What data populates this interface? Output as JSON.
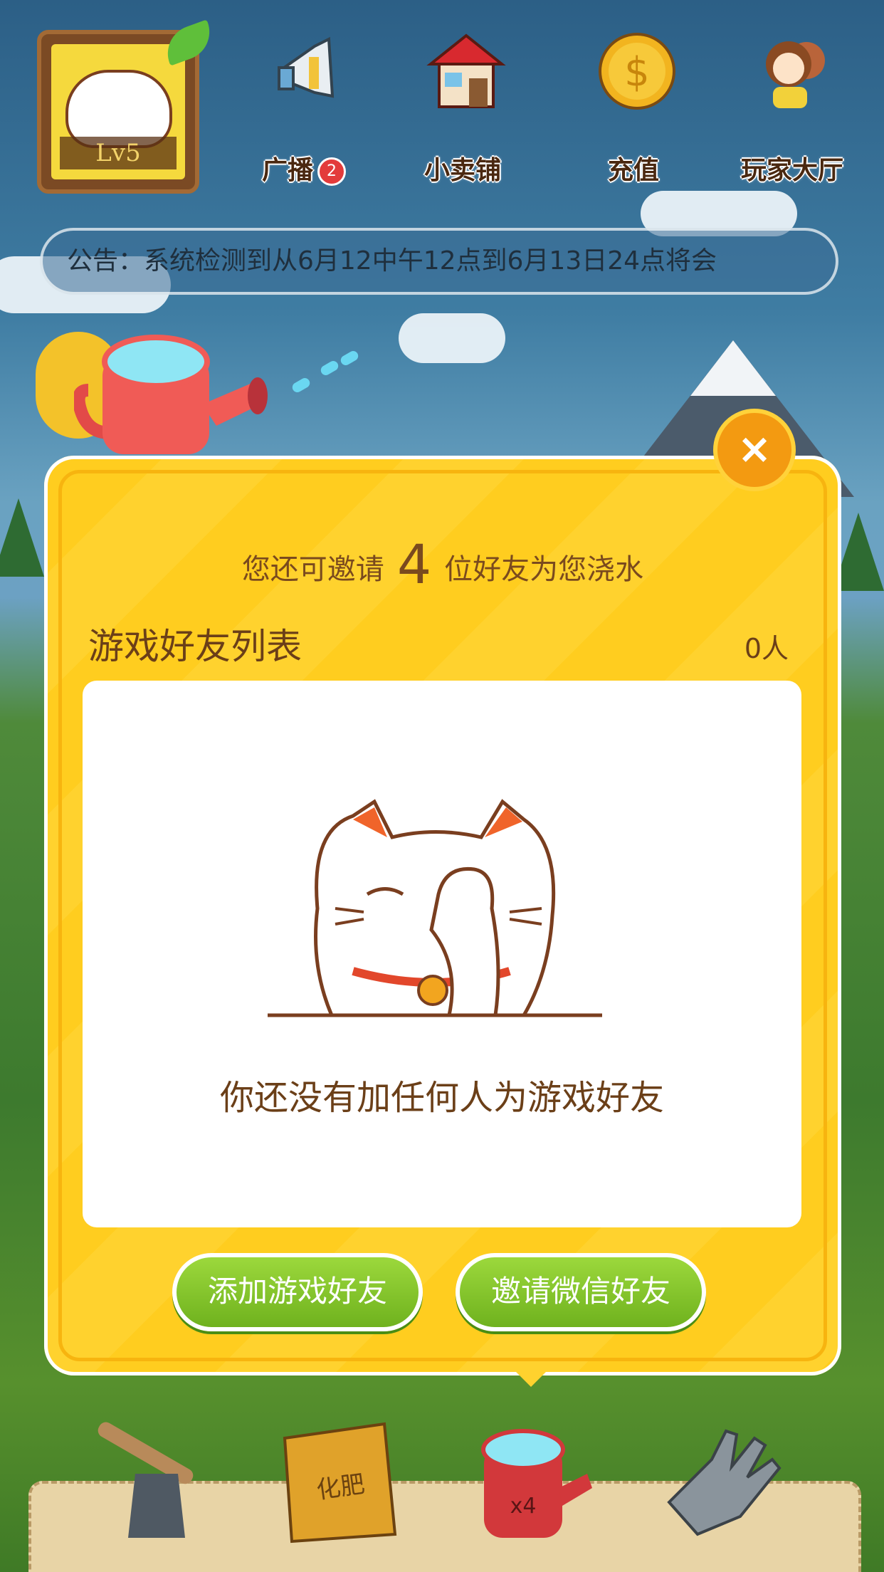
{
  "player": {
    "level": "Lv5"
  },
  "top_nav": [
    {
      "label": "广播",
      "badge": "2",
      "icon": "megaphone-icon"
    },
    {
      "label": "小卖铺",
      "icon": "shop-icon"
    },
    {
      "label": "充值",
      "icon": "coin-icon"
    },
    {
      "label": "玩家大厅",
      "icon": "players-icon"
    }
  ],
  "notice": {
    "text": "公告：系统检测到从6月12中午12点到6月13日24点将会"
  },
  "popup": {
    "invite_prefix": "您还可邀请",
    "invite_count": "4",
    "invite_suffix": "位好友为您浇水",
    "list_title": "游戏好友列表",
    "list_count": "0人",
    "empty_text": "你还没有加任何人为游戏好友",
    "add_friend_button": "添加游戏好友",
    "invite_wechat_button": "邀请微信好友",
    "close_icon": "close-icon"
  },
  "tools": [
    {
      "icon": "axe-icon"
    },
    {
      "icon": "fertilizer-bag-icon",
      "label": "化肥"
    },
    {
      "icon": "watering-can-icon",
      "label": "x4"
    },
    {
      "icon": "glove-icon"
    }
  ],
  "colors": {
    "popup_yellow": "#ffcd1f",
    "button_green": "#7fc32a",
    "close_orange": "#f39a11",
    "text_brown": "#6b3f18"
  }
}
